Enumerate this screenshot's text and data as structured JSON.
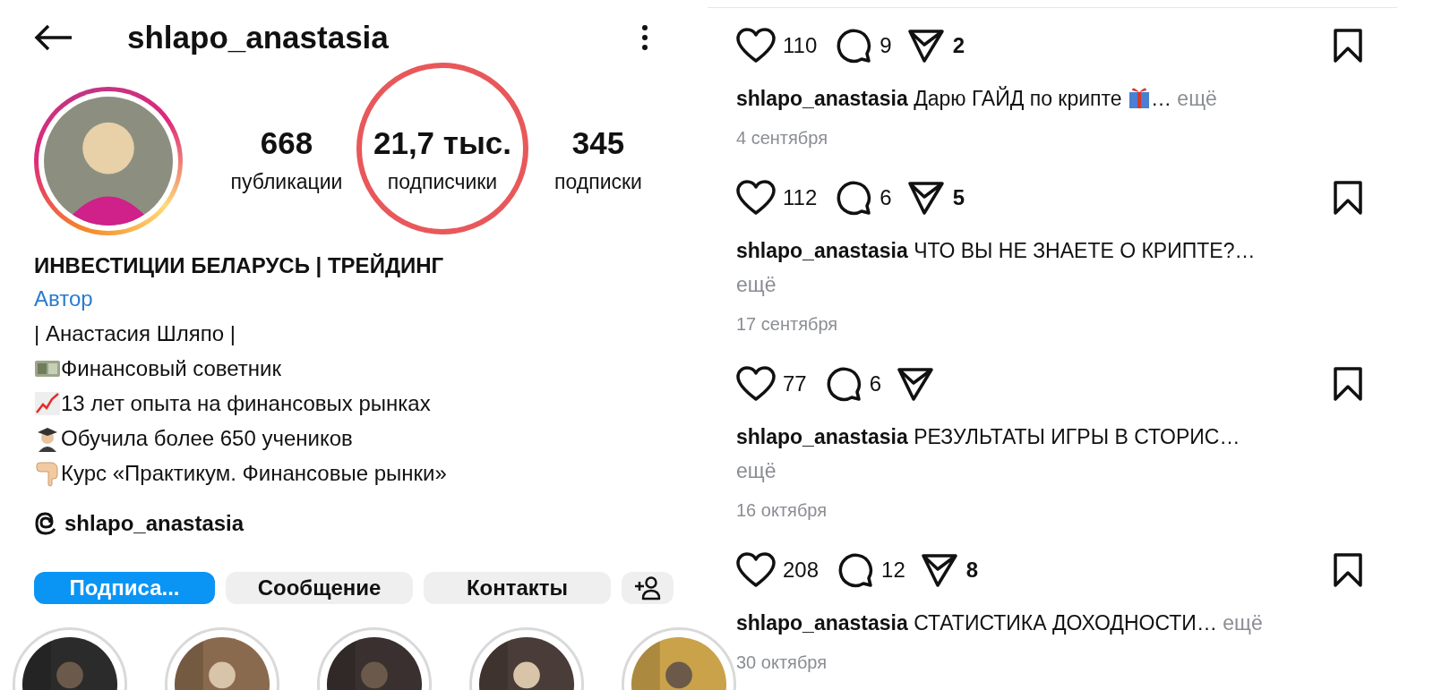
{
  "profile": {
    "username": "shlapo_anastasia",
    "stats": [
      {
        "value": "668",
        "label": "публикации",
        "highlighted": false
      },
      {
        "value": "21,7 тыс.",
        "label": "подписчики",
        "highlighted": true
      },
      {
        "value": "345",
        "label": "подписки",
        "highlighted": false
      }
    ],
    "name": "ИНВЕСТИЦИИ БЕЛАРУСЬ | ТРЕЙДИНГ",
    "bio": [
      {
        "kind": "link",
        "text": "Автор"
      },
      {
        "kind": "plain",
        "text": "| Анастасия Шляпо |"
      },
      {
        "kind": "money",
        "text": "Финансовый советник"
      },
      {
        "kind": "chart",
        "text": "13 лет опыта на финансовых рынках"
      },
      {
        "kind": "teacher",
        "text": "Обучила более 650 учеников"
      },
      {
        "kind": "pointing",
        "text": "Курс «Практикум. Финансовые рынки»"
      }
    ],
    "threads": "shlapo_anastasia",
    "buttons": [
      {
        "kind": "primary",
        "label": "Подписа..."
      },
      {
        "kind": "secondary",
        "label": "Сообщение"
      },
      {
        "kind": "secondary",
        "label": "Контакты"
      },
      {
        "kind": "add-person"
      }
    ]
  },
  "posts": [
    {
      "likes": "110",
      "comments": "9",
      "shares": "2",
      "username": "shlapo_anastasia",
      "caption": "Дарю ГАЙД по крипте",
      "gift": true,
      "ellipsis": "…",
      "more": "ещё",
      "more_on_new_line": false,
      "date": "4 сентября"
    },
    {
      "likes": "112",
      "comments": "6",
      "shares": "5",
      "username": "shlapo_anastasia",
      "caption": "ЧТО ВЫ НЕ ЗНАЕТЕ О КРИПТЕ?",
      "gift": false,
      "ellipsis": "…",
      "more": "ещё",
      "more_on_new_line": true,
      "date": "17 сентября"
    },
    {
      "likes": "77",
      "comments": "6",
      "username": "shlapo_anastasia",
      "caption": "РЕЗУЛЬТАТЫ ИГРЫ В СТОРИС",
      "gift": false,
      "ellipsis": "…",
      "more": "ещё",
      "more_on_new_line": true,
      "date": "16 октября"
    },
    {
      "likes": "208",
      "comments": "12",
      "shares": "8",
      "username": "shlapo_anastasia",
      "caption": "СТАТИСТИКА ДОХОДНОСТИ",
      "gift": false,
      "ellipsis": "…",
      "more": "ещё",
      "more_on_new_line": false,
      "date": "30 октября"
    }
  ]
}
